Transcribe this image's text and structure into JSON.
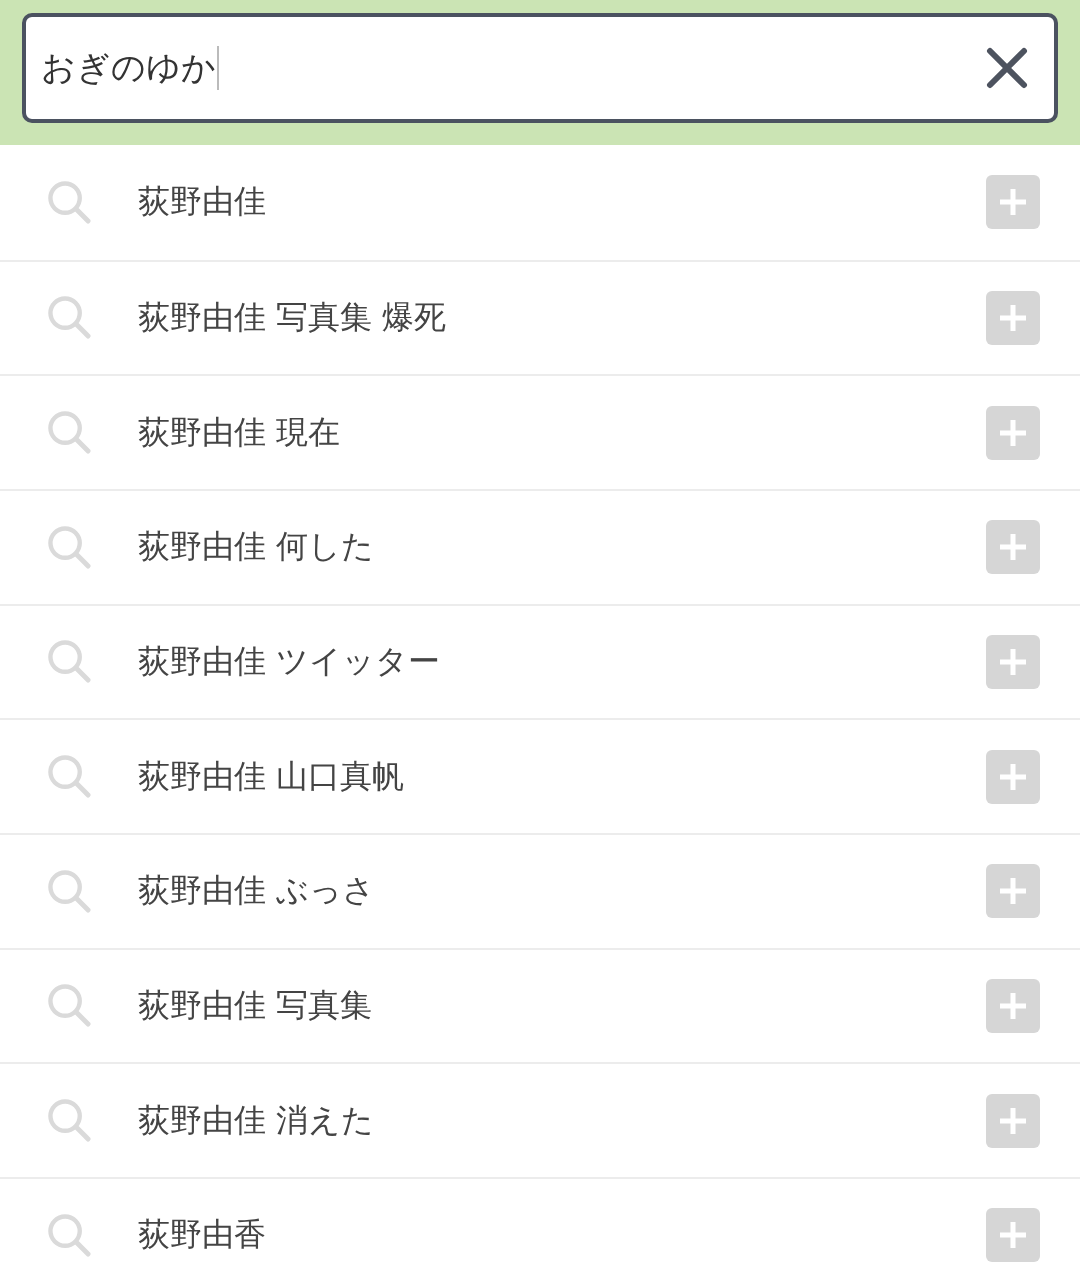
{
  "search": {
    "value": "おぎのゆか",
    "focused": true
  },
  "suggestions": [
    {
      "text": "荻野由佳"
    },
    {
      "text": "荻野由佳 写真集 爆死"
    },
    {
      "text": "荻野由佳 現在"
    },
    {
      "text": "荻野由佳 何した"
    },
    {
      "text": "荻野由佳 ツイッター"
    },
    {
      "text": "荻野由佳 山口真帆"
    },
    {
      "text": "荻野由佳 ぶっさ"
    },
    {
      "text": "荻野由佳 写真集"
    },
    {
      "text": "荻野由佳 消えた"
    },
    {
      "text": "荻野由香"
    }
  ]
}
